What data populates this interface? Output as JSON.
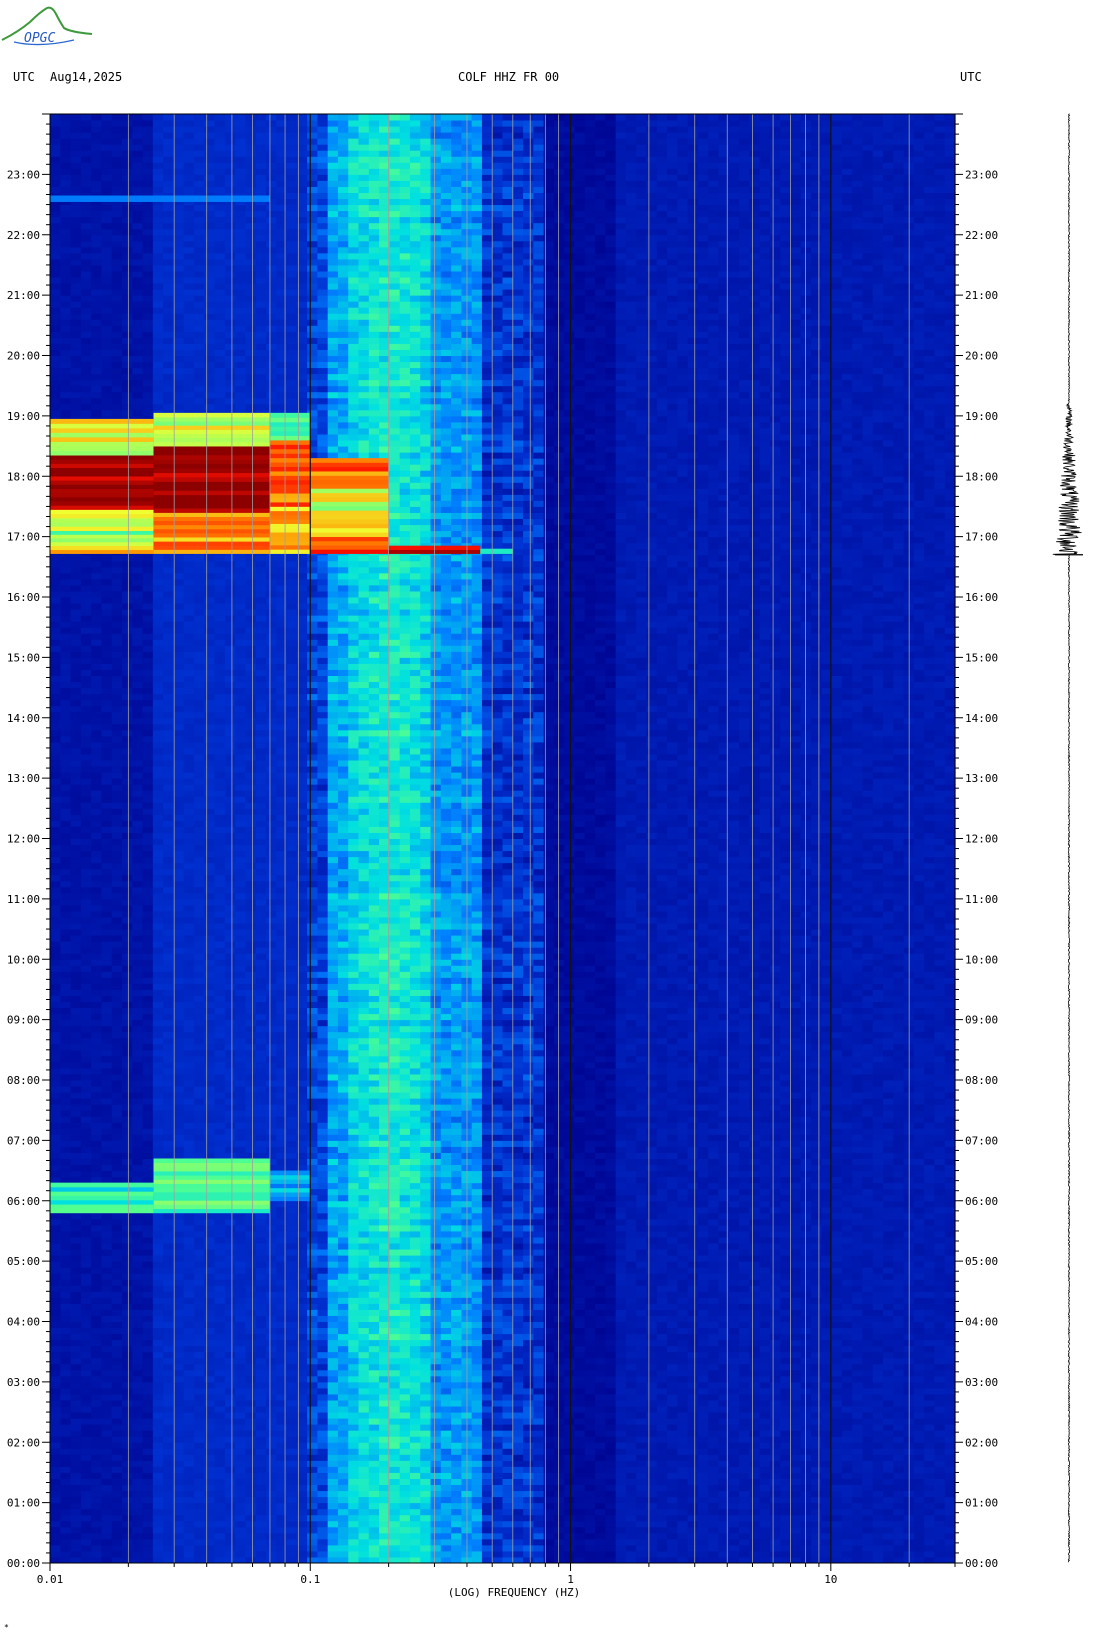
{
  "logo": {
    "text": "OPGC"
  },
  "header": {
    "left_tz": "UTC",
    "date": "Aug14,2025",
    "station": "COLF HHZ FR 00",
    "right_tz": "UTC"
  },
  "chart_data": {
    "type": "heatmap",
    "title": "COLF HHZ FR 00",
    "xlabel": "(LOG) FREQUENCY (HZ)",
    "x_scale": "log",
    "xlim": [
      0.01,
      30
    ],
    "x_ticks": [
      {
        "value": 0.01,
        "label": "0.01"
      },
      {
        "value": 0.1,
        "label": "0.1"
      },
      {
        "value": 1,
        "label": "1"
      },
      {
        "value": 10,
        "label": "10"
      }
    ],
    "ylabel": "",
    "ylim_hours": [
      0,
      24
    ],
    "y_ticks": [
      "00:00",
      "01:00",
      "02:00",
      "03:00",
      "04:00",
      "05:00",
      "06:00",
      "07:00",
      "08:00",
      "09:00",
      "10:00",
      "11:00",
      "12:00",
      "13:00",
      "14:00",
      "15:00",
      "16:00",
      "17:00",
      "18:00",
      "19:00",
      "20:00",
      "21:00",
      "22:00",
      "23:00"
    ],
    "background_level": "low",
    "microseism_band_hz": [
      0.12,
      0.45
    ],
    "microseism_peak_hz": [
      0.14,
      0.3
    ],
    "events": [
      {
        "name": "earthquake",
        "onset_hour": 16.72,
        "end_hour": 18.15,
        "max_freq_hz": 0.6,
        "segments": [
          {
            "f0": 0.01,
            "f1": 0.025,
            "h0": 16.72,
            "h1": 16.85,
            "level": 0.72
          },
          {
            "f0": 0.01,
            "f1": 0.025,
            "h0": 16.85,
            "h1": 17.1,
            "level": 0.55
          },
          {
            "f0": 0.01,
            "f1": 0.025,
            "h0": 17.1,
            "h1": 17.45,
            "level": 0.62
          },
          {
            "f0": 0.01,
            "f1": 0.025,
            "h0": 17.45,
            "h1": 18.35,
            "level": 0.97
          },
          {
            "f0": 0.01,
            "f1": 0.025,
            "h0": 18.35,
            "h1": 18.95,
            "level": 0.62
          },
          {
            "f0": 0.025,
            "f1": 0.07,
            "h0": 16.72,
            "h1": 17.4,
            "level": 0.75
          },
          {
            "f0": 0.025,
            "f1": 0.07,
            "h0": 17.4,
            "h1": 18.5,
            "level": 1.0
          },
          {
            "f0": 0.025,
            "f1": 0.07,
            "h0": 18.5,
            "h1": 19.05,
            "level": 0.6
          },
          {
            "f0": 0.07,
            "f1": 0.1,
            "h0": 16.72,
            "h1": 17.5,
            "level": 0.72
          },
          {
            "f0": 0.07,
            "f1": 0.1,
            "h0": 17.5,
            "h1": 18.6,
            "level": 0.8
          },
          {
            "f0": 0.07,
            "f1": 0.1,
            "h0": 18.6,
            "h1": 19.05,
            "level": 0.5
          },
          {
            "f0": 0.1,
            "f1": 0.2,
            "h0": 16.72,
            "h1": 17.0,
            "level": 0.85
          },
          {
            "f0": 0.1,
            "f1": 0.2,
            "h0": 17.0,
            "h1": 17.8,
            "level": 0.62
          },
          {
            "f0": 0.1,
            "f1": 0.2,
            "h0": 17.8,
            "h1": 18.3,
            "level": 0.78
          },
          {
            "f0": 0.2,
            "f1": 0.45,
            "h0": 16.72,
            "h1": 16.85,
            "level": 0.95
          },
          {
            "f0": 0.45,
            "f1": 0.6,
            "h0": 16.72,
            "h1": 16.8,
            "level": 0.5
          }
        ]
      },
      {
        "name": "teleseism",
        "onset_hour": 5.8,
        "end_hour": 6.7,
        "segments": [
          {
            "f0": 0.01,
            "f1": 0.025,
            "h0": 5.8,
            "h1": 6.3,
            "level": 0.42
          },
          {
            "f0": 0.025,
            "f1": 0.07,
            "h0": 5.8,
            "h1": 6.7,
            "level": 0.48
          },
          {
            "f0": 0.07,
            "f1": 0.1,
            "h0": 6.0,
            "h1": 6.5,
            "level": 0.3
          }
        ]
      },
      {
        "name": "narrow-band-line",
        "onset_hour": 22.55,
        "end_hour": 22.65,
        "segments": [
          {
            "f0": 0.01,
            "f1": 0.07,
            "h0": 22.55,
            "h1": 22.65,
            "level": 0.32
          }
        ]
      }
    ],
    "colormap": [
      "#00008c",
      "#0030d0",
      "#0080ff",
      "#00e0e0",
      "#50ff90",
      "#f0ff30",
      "#ff9000",
      "#ff1000",
      "#8c0000"
    ],
    "grid": true,
    "seismogram": {
      "position": "right",
      "active_start_hour": 16.7,
      "active_end_hour": 19.2
    }
  },
  "footer": {
    "mark": "*"
  }
}
